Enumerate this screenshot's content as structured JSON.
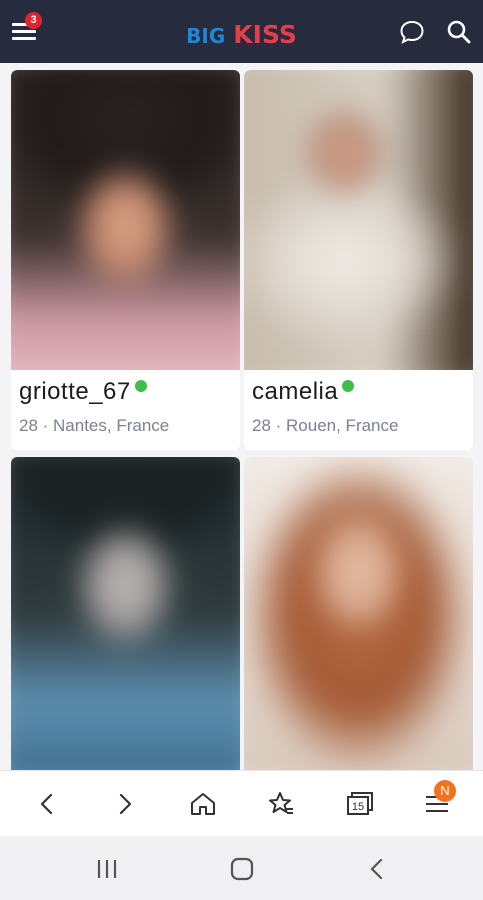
{
  "header": {
    "menu_badge": "3",
    "logo_big": "BIG",
    "logo_kiss": "KISS",
    "icons": [
      "menu-icon",
      "chat-bubble-icon",
      "search-icon"
    ]
  },
  "profiles": [
    {
      "username": "griotte_67",
      "meta": "28 · Nantes, France",
      "online": true
    },
    {
      "username": "camelia",
      "meta": "28 · Rouen, France",
      "online": true
    },
    {
      "username": "",
      "meta": "",
      "online": true
    },
    {
      "username": "",
      "meta": "",
      "online": true
    }
  ],
  "browser_nav": {
    "icons": [
      "back-arrow-icon",
      "forward-arrow-icon",
      "home-icon",
      "bookmarks-star-icon",
      "tabs-icon",
      "browser-menu-icon"
    ],
    "tabs_count": "15",
    "menu_badge": "N"
  },
  "system_nav": {
    "icons": [
      "recent-apps-icon",
      "home-circle-icon",
      "back-chevron-icon"
    ]
  },
  "colors": {
    "header_bg": "#262c3d",
    "logo_blue": "#1f86d8",
    "logo_red": "#e43e4a",
    "online_green": "#3cc04a",
    "badge_red": "#e4212f",
    "badge_orange": "#f3731d"
  }
}
